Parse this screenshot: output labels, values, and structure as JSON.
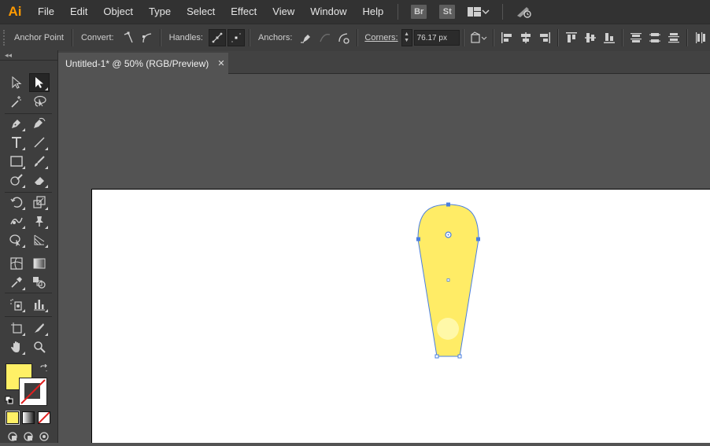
{
  "app": {
    "logo": "Ai"
  },
  "menu": [
    "File",
    "Edit",
    "Object",
    "Type",
    "Select",
    "Effect",
    "View",
    "Window",
    "Help"
  ],
  "app_buttons": [
    "Br",
    "St"
  ],
  "control_bar": {
    "tool_name": "Anchor Point",
    "convert_label": "Convert:",
    "handles_label": "Handles:",
    "anchors_label": "Anchors:",
    "corners_label": "Corners:",
    "corners_value": "76.17 px"
  },
  "document": {
    "tab_title": "Untitled-1* @ 50% (RGB/Preview)",
    "close_glyph": "✕"
  },
  "toolbar": {
    "collapse_glyph": "◂◂"
  },
  "colors": {
    "fill": "#fff066",
    "shape_fill": "#ffec66",
    "highlight": "#fff8a8",
    "selection": "#4a7fe0"
  }
}
